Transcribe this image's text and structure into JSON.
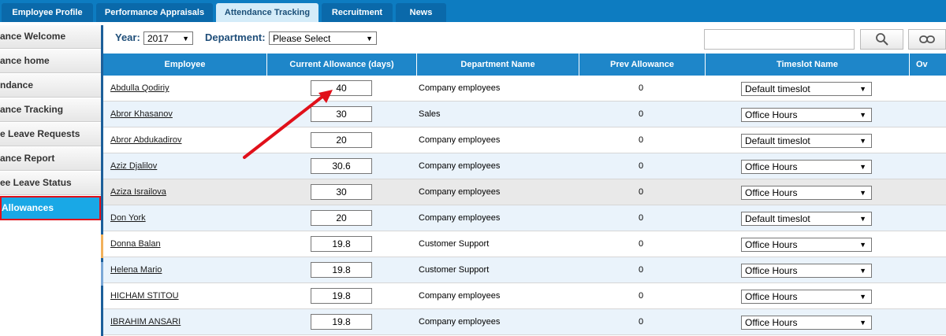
{
  "tabs": [
    "Employee Profile",
    "Performance Appraisals",
    "Attendance Tracking",
    "Recruitment",
    "News"
  ],
  "sidebar": [
    "ance Welcome",
    "ance home",
    "ndance",
    "ance Tracking",
    "e Leave Requests",
    "ance Report",
    "ee Leave Status",
    "Allowances"
  ],
  "filters": {
    "year_label": "Year:",
    "year_value": "2017",
    "dept_label": "Department:",
    "dept_value": "Please Select"
  },
  "columns": [
    "Employee",
    "Current Allowance (days)",
    "Department Name",
    "Prev Allowance",
    "Timeslot Name",
    "Ov"
  ],
  "rows": [
    {
      "employee": "Abdulla Qodiriy",
      "allowance": "40",
      "department": "Company employees",
      "prev": "0",
      "timeslot": "Default timeslot"
    },
    {
      "employee": "Abror Khasanov",
      "allowance": "30",
      "department": "Sales",
      "prev": "0",
      "timeslot": "Office Hours"
    },
    {
      "employee": "Abror Abdukadirov",
      "allowance": "20",
      "department": "Company employees",
      "prev": "0",
      "timeslot": "Default timeslot"
    },
    {
      "employee": "Aziz Djalilov",
      "allowance": "30.6",
      "department": "Company employees",
      "prev": "0",
      "timeslot": "Office Hours"
    },
    {
      "employee": "Aziza Israilova",
      "allowance": "30",
      "department": "Company employees",
      "prev": "0",
      "timeslot": "Office Hours"
    },
    {
      "employee": "Don York",
      "allowance": "20",
      "department": "Company employees",
      "prev": "0",
      "timeslot": "Default timeslot"
    },
    {
      "employee": "Donna Balan",
      "allowance": "19.8",
      "department": "Customer Support",
      "prev": "0",
      "timeslot": "Office Hours"
    },
    {
      "employee": "Helena Mario",
      "allowance": "19.8",
      "department": "Customer Support",
      "prev": "0",
      "timeslot": "Office Hours"
    },
    {
      "employee": "HICHAM STITOU",
      "allowance": "19.8",
      "department": "Company employees",
      "prev": "0",
      "timeslot": "Office Hours"
    },
    {
      "employee": "IBRAHIM ANSARI",
      "allowance": "19.8",
      "department": "Company employees",
      "prev": "0",
      "timeslot": "Office Hours"
    }
  ],
  "colors": {
    "header_blue": "#1e86c9",
    "topbar_blue": "#0d7cc1",
    "active_sidebar": "#19a8e6",
    "highlight_red": "#e0101a",
    "row_alt": "#eaf3fb"
  }
}
